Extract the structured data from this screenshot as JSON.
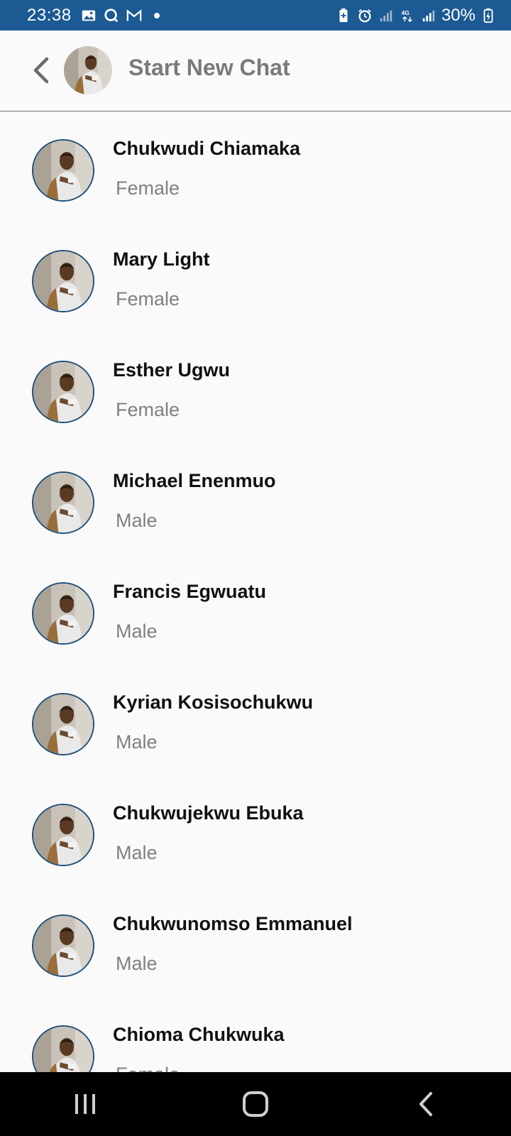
{
  "status_bar": {
    "time": "23:38",
    "battery": "30%",
    "network": "4G"
  },
  "header": {
    "title": "Start New Chat"
  },
  "contacts": [
    {
      "name": "Chukwudi Chiamaka",
      "gender": "Female"
    },
    {
      "name": "Mary Light",
      "gender": "Female"
    },
    {
      "name": "Esther Ugwu",
      "gender": "Female"
    },
    {
      "name": "Michael Enenmuo",
      "gender": "Male"
    },
    {
      "name": "Francis Egwuatu",
      "gender": "Male"
    },
    {
      "name": "Kyrian Kosisochukwu",
      "gender": "Male"
    },
    {
      "name": "Chukwujekwu Ebuka",
      "gender": "Male"
    },
    {
      "name": "Chukwunomso Emmanuel",
      "gender": "Male"
    },
    {
      "name": "Chioma Chukwuka",
      "gender": "Female"
    }
  ],
  "colors": {
    "status_bar": "#1b5a93",
    "avatar_border": "#1f4f7a",
    "title_gray": "#7a7a7a"
  }
}
